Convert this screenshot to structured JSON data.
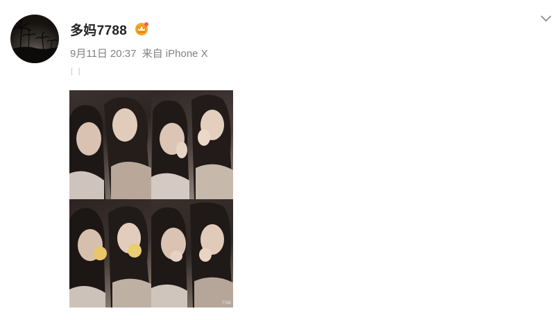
{
  "post": {
    "username": "多妈7788",
    "date": "9月11日",
    "time": "20:37",
    "source": "来自 iPhone X",
    "text": "| |",
    "image_watermark": "7788"
  },
  "icons": {
    "vip": "vip-crown-icon",
    "menu": "chevron-down-icon"
  },
  "colors": {
    "username": "#222222",
    "meta": "#808080",
    "badge": "#f5a623"
  }
}
